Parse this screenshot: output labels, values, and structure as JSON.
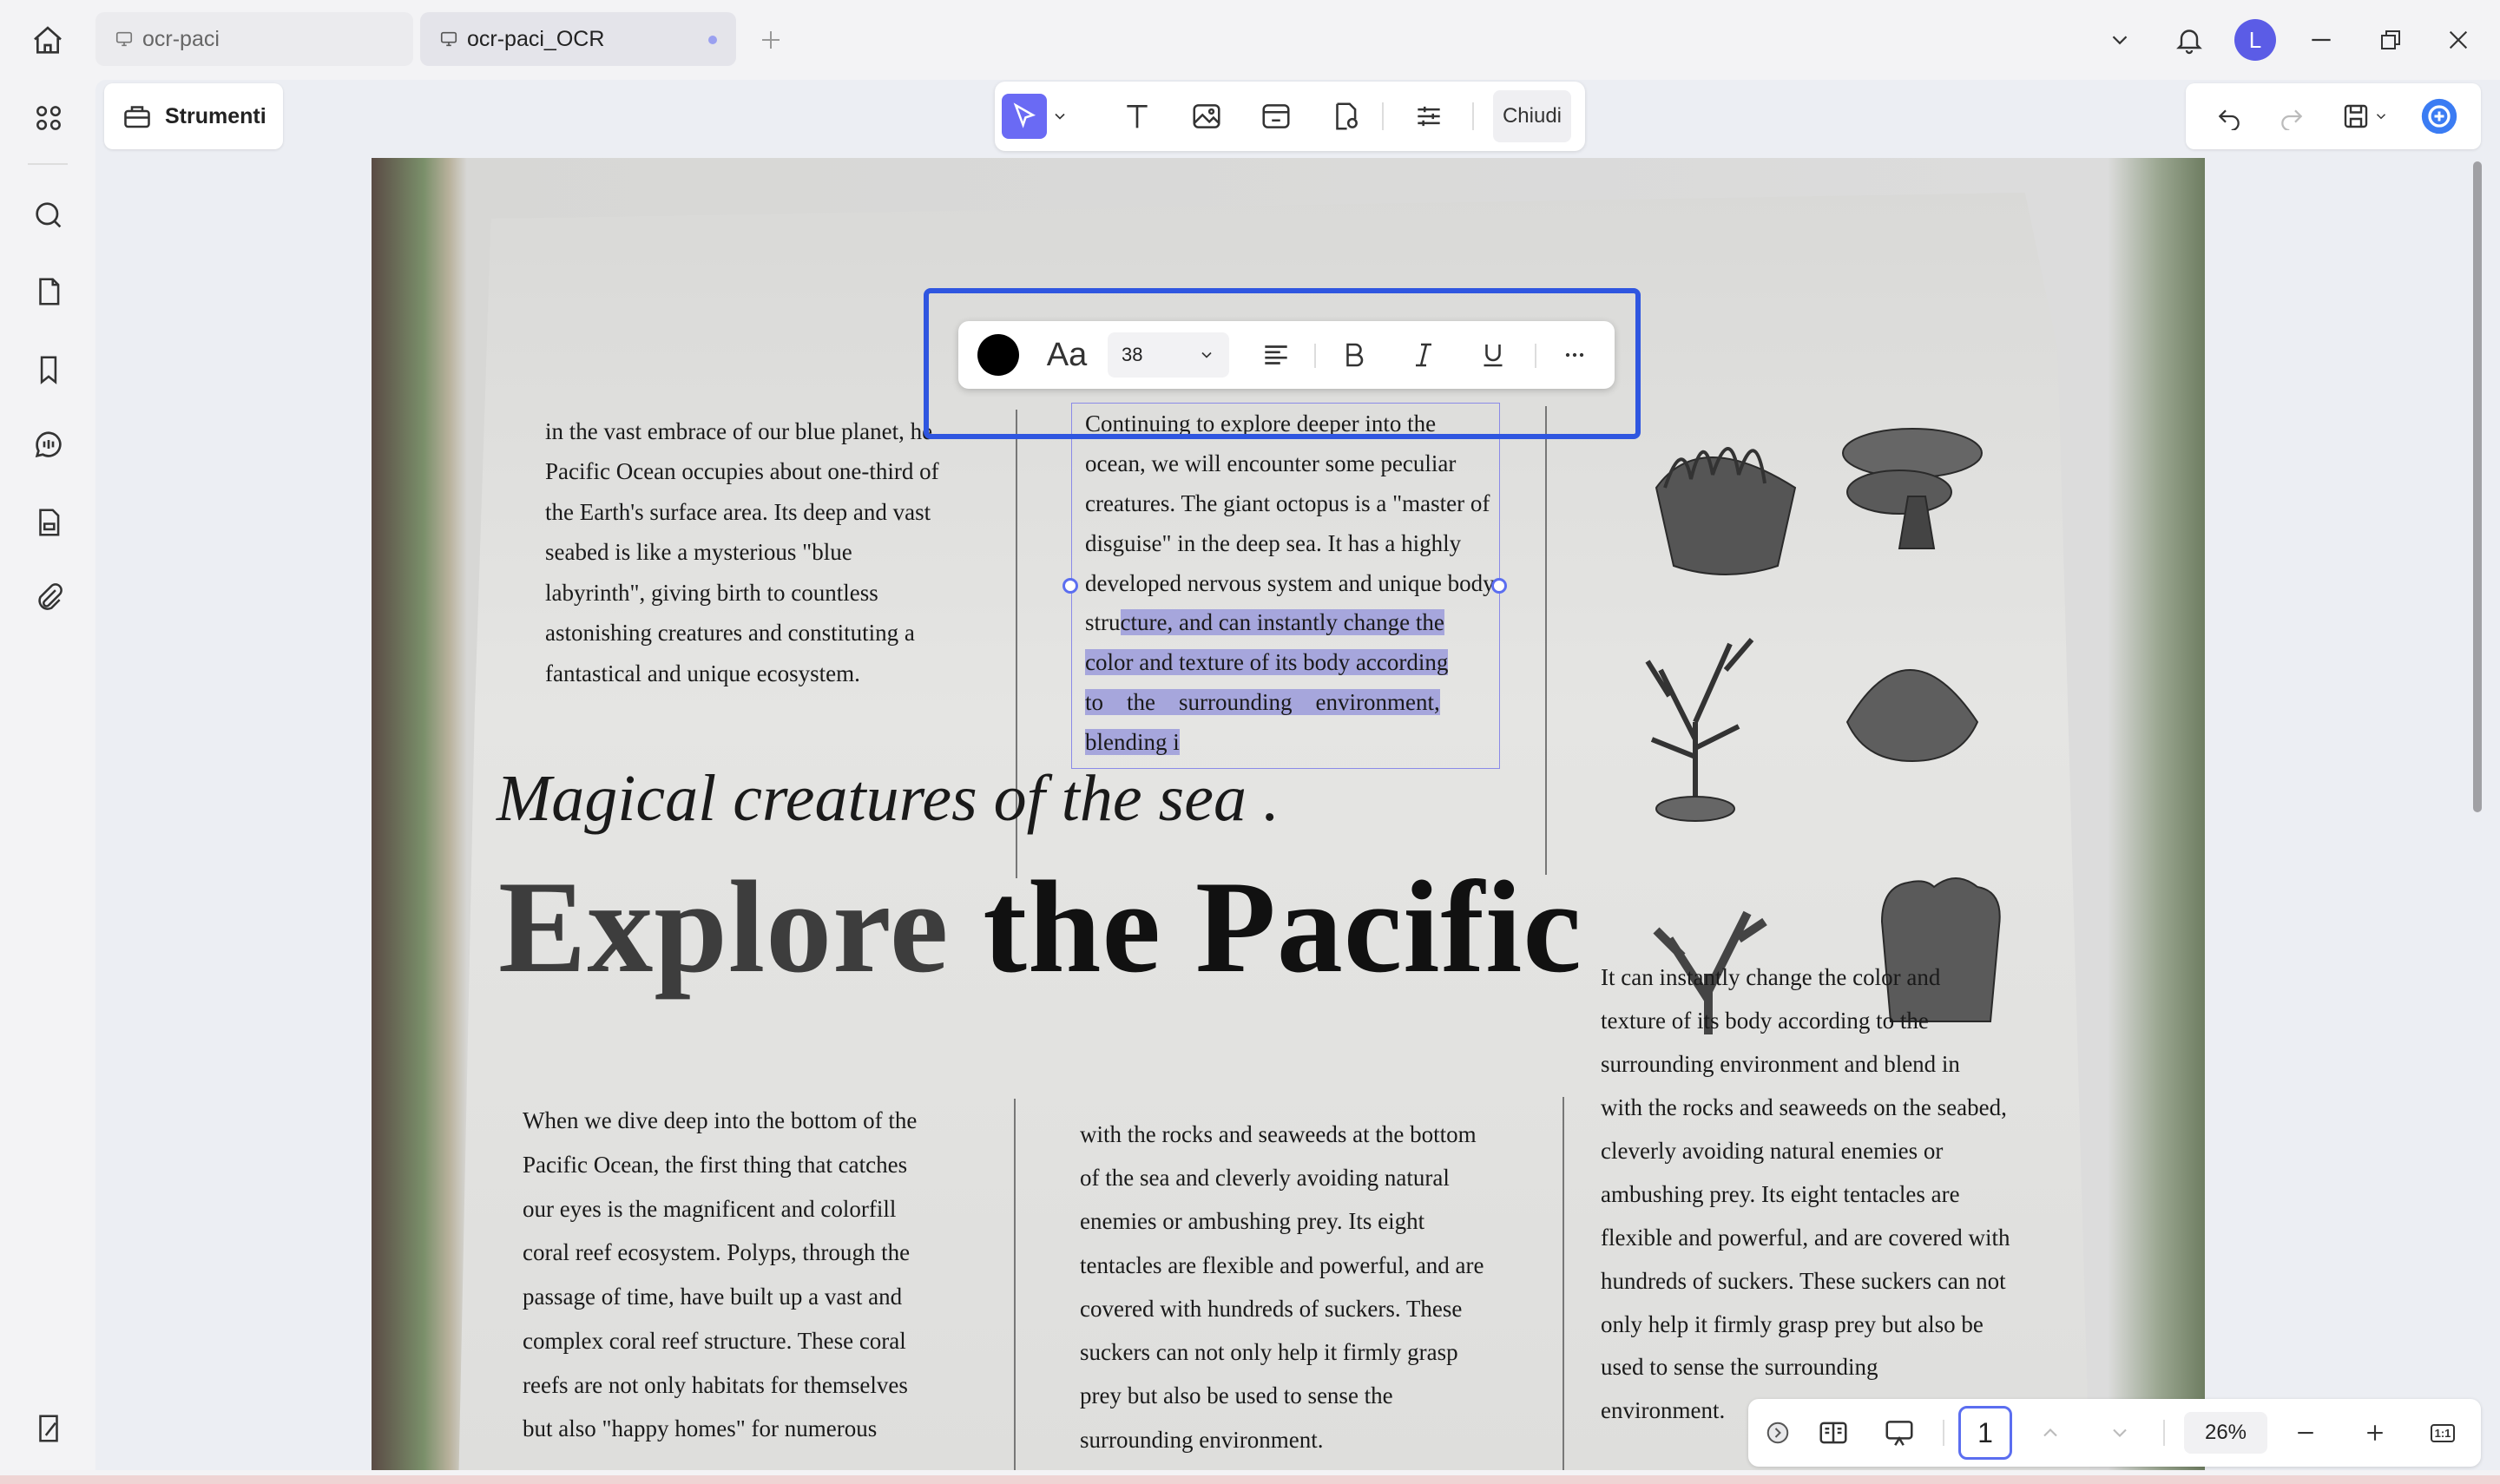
{
  "tabs": [
    {
      "label": "ocr-paci"
    },
    {
      "label": "ocr-paci_OCR"
    }
  ],
  "user": {
    "avatar_initial": "L"
  },
  "left_panel": {
    "tools_label": "Strumenti"
  },
  "edit_toolbar": {
    "close_label": "Chiudi"
  },
  "text_toolbar": {
    "font_size": "38",
    "font_glyph": "Aa",
    "text_color": "#000000"
  },
  "document": {
    "col1_text": "in the vast embrace of our blue planet, he\nPacific Ocean occupies about one-third of\nthe Earth's surface area. Its deep and vast\nseabed is like a mysterious \"blue\nlabyrinth\", giving birth to countless\nastonishing creatures and constituting a\nfantastical and unique ecosystem.",
    "col2_plain": "Continuing to explore deeper into the\nocean, we will encounter some peculiar\ncreatures. The giant octopus is a \"master of\ndisguise\" in the deep sea. It has a highly\ndeveloped nervous system and unique body\nstru",
    "col2_selected": "cture, and can instantly change the\ncolor and texture of its body according\nto    the    surrounding    environment,\nblending i",
    "subtitle": "Magical creatures of the sea .",
    "headline_light": "Explore ",
    "headline_bold": "the Pacific",
    "col_right_text": "It can instantly change the color and\ntexture of its body according to the\nsurrounding environment and blend in\nwith the rocks and seaweeds on the seabed,\ncleverly avoiding natural enemies or\nambushing prey. Its eight tentacles are\nflexible and powerful, and are covered with\nhundreds of suckers. These suckers can not\nonly help it firmly grasp prey but also be\nused to sense the surrounding\nenvironment.",
    "col_b1_text": "When we dive deep into the bottom of the\nPacific Ocean, the first thing that catches\nour eyes is the magnificent and colorfill\ncoral reef ecosystem. Polyps, through the\npassage of time, have built up a vast and\ncomplex coral reef structure. These coral\nreefs are not only habitats for themselves\nbut also \"happy homes\" for numerous",
    "col_b2_text": "with the rocks and seaweeds at the bottom\nof the sea and cleverly avoiding natural\nenemies or ambushing prey. Its eight\ntentacles are flexible and powerful, and are\ncovered with hundreds of suckers. These\nsuckers can not only help it firmly grasp\nprey but also be used to sense the\nsurrounding environment."
  },
  "bottom_nav": {
    "page": "1",
    "zoom": "26%",
    "fit_label": "1:1"
  },
  "colors": {
    "accent": "#6a6af4",
    "selection_frame": "#2f56e0",
    "text_highlight": "#a6a6dc",
    "avatar": "#5b5ce6"
  }
}
